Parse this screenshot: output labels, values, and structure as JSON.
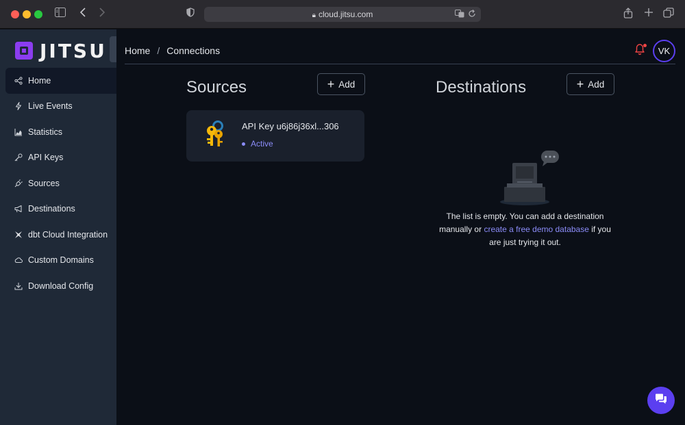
{
  "browser": {
    "url": "cloud.jitsu.com"
  },
  "app": {
    "logo_text": "JITSU",
    "accent_color": "#5b3ff0",
    "brand_color": "#8b3df0"
  },
  "sidebar": {
    "items": [
      {
        "label": "Home",
        "icon": "share-nodes-icon",
        "active": true
      },
      {
        "label": "Live Events",
        "icon": "lightning-icon",
        "active": false
      },
      {
        "label": "Statistics",
        "icon": "area-chart-icon",
        "active": false
      },
      {
        "label": "API Keys",
        "icon": "key-icon",
        "active": false
      },
      {
        "label": "Sources",
        "icon": "plug-icon",
        "active": false
      },
      {
        "label": "Destinations",
        "icon": "megaphone-icon",
        "active": false
      },
      {
        "label": "dbt Cloud Integration",
        "icon": "dbt-icon",
        "active": false
      },
      {
        "label": "Custom Domains",
        "icon": "cloud-icon",
        "active": false
      },
      {
        "label": "Download Config",
        "icon": "download-icon",
        "active": false
      }
    ]
  },
  "header": {
    "breadcrumb": [
      "Home",
      "Connections"
    ],
    "breadcrumb_separator": "/",
    "avatar_initials": "VK"
  },
  "sources": {
    "title": "Sources",
    "add_label": "Add",
    "cards": [
      {
        "title": "API Key u6j86j36xl...306",
        "status": "Active"
      }
    ]
  },
  "destinations": {
    "title": "Destinations",
    "add_label": "Add",
    "empty_text_before": "The list is empty. You can add a destination manually or ",
    "empty_link": "create a free demo database",
    "empty_text_after": " if you are just trying it out."
  }
}
